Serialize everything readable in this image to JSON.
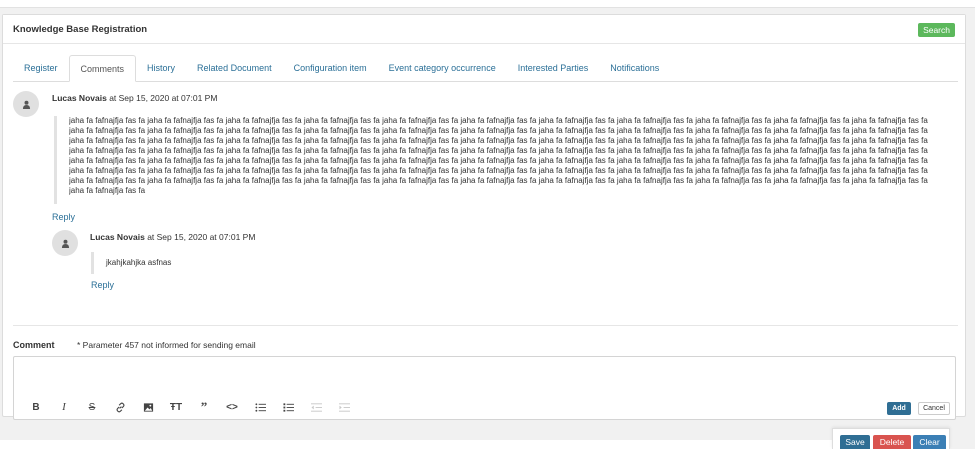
{
  "panel": {
    "title": "Knowledge Base Registration",
    "search_label": "Search"
  },
  "tabs": [
    {
      "label": "Register",
      "active": false
    },
    {
      "label": "Comments",
      "active": true
    },
    {
      "label": "History",
      "active": false
    },
    {
      "label": "Related Document",
      "active": false
    },
    {
      "label": "Configuration item",
      "active": false
    },
    {
      "label": "Event category occurrence",
      "active": false
    },
    {
      "label": "Interested Parties",
      "active": false
    },
    {
      "label": "Notifications",
      "active": false
    }
  ],
  "comments": [
    {
      "author": "Lucas Novais",
      "timestamp": "at Sep 15, 2020 at 07:01 PM",
      "lines": [
        "jaha fa fafnajfja fas fa jaha fa fafnajfja fas fa jaha fa fafnajfja fas fa jaha fa fafnajfja fas fa jaha fa fafnajfja fas fa jaha fa fafnajfja fas fa jaha fa fafnajfja fas fa jaha fa fafnajfja fas fa jaha fa fafnajfja fas fa jaha fa fafnajfja fas fa jaha fa fafnajfja fas fa",
        "jaha fa fafnajfja fas fa jaha fa fafnajfja fas fa jaha fa fafnajfja fas fa jaha fa fafnajfja fas fa jaha fa fafnajfja fas fa jaha fa fafnajfja fas fa jaha fa fafnajfja fas fa jaha fa fafnajfja fas fa jaha fa fafnajfja fas fa jaha fa fafnajfja fas fa jaha fa fafnajfja fas fa",
        "jaha fa fafnajfja fas fa jaha fa fafnajfja fas fa jaha fa fafnajfja fas fa jaha fa fafnajfja fas fa jaha fa fafnajfja fas fa jaha fa fafnajfja fas fa jaha fa fafnajfja fas fa jaha fa fafnajfja fas fa jaha fa fafnajfja fas fa jaha fa fafnajfja fas fa jaha fa fafnajfja fas fa",
        "jaha fa fafnajfja fas fa jaha fa fafnajfja fas fa jaha fa fafnajfja fas fa jaha fa fafnajfja fas fa jaha fa fafnajfja fas fa jaha fa fafnajfja fas fa jaha fa fafnajfja fas fa jaha fa fafnajfja fas fa jaha fa fafnajfja fas fa jaha fa fafnajfja fas fa jaha fa fafnajfja fas fa",
        "jaha fa fafnajfja fas fa jaha fa fafnajfja fas fa jaha fa fafnajfja fas fa jaha fa fafnajfja fas fa jaha fa fafnajfja fas fa jaha fa fafnajfja fas fa jaha fa fafnajfja fas fa jaha fa fafnajfja fas fa jaha fa fafnajfja fas fa jaha fa fafnajfja fas fa jaha fa fafnajfja fas fa",
        "jaha fa fafnajfja fas fa jaha fa fafnajfja fas fa jaha fa fafnajfja fas fa jaha fa fafnajfja fas fa jaha fa fafnajfja fas fa jaha fa fafnajfja fas fa jaha fa fafnajfja fas fa jaha fa fafnajfja fas fa jaha fa fafnajfja fas fa jaha fa fafnajfja fas fa jaha fa fafnajfja fas fa",
        "jaha fa fafnajfja fas fa jaha fa fafnajfja fas fa jaha fa fafnajfja fas fa jaha fa fafnajfja fas fa jaha fa fafnajfja fas fa jaha fa fafnajfja fas fa jaha fa fafnajfja fas fa jaha fa fafnajfja fas fa jaha fa fafnajfja fas fa jaha fa fafnajfja fas fa jaha fa fafnajfja fas fa",
        "jaha fa fafnajfja fas fa"
      ],
      "reply_label": "Reply"
    },
    {
      "author": "Lucas Novais",
      "timestamp": "at Sep 15, 2020 at 07:01 PM",
      "lines": [
        "jkahjkahjka asfnas"
      ],
      "reply_label": "Reply"
    }
  ],
  "comment_form": {
    "label": "Comment",
    "notice": "* Parameter 457 not informed for sending email",
    "editor_value": "",
    "add_label": "Add",
    "cancel_label": "Cancel",
    "toolbar": [
      "bold-icon",
      "italic-icon",
      "strikethrough-icon",
      "link-icon",
      "image-icon",
      "heading-icon",
      "quote-icon",
      "code-icon",
      "bullet-list-icon",
      "numbered-list-icon",
      "outdent-icon",
      "indent-icon"
    ]
  },
  "actions": {
    "save_label": "Save",
    "delete_label": "Delete",
    "clear_label": "Clear"
  },
  "colors": {
    "link": "#2a6f97",
    "search": "#5cb85c",
    "primary": "#2f6e94",
    "danger": "#d9534f",
    "clear": "#3b7fb5"
  }
}
